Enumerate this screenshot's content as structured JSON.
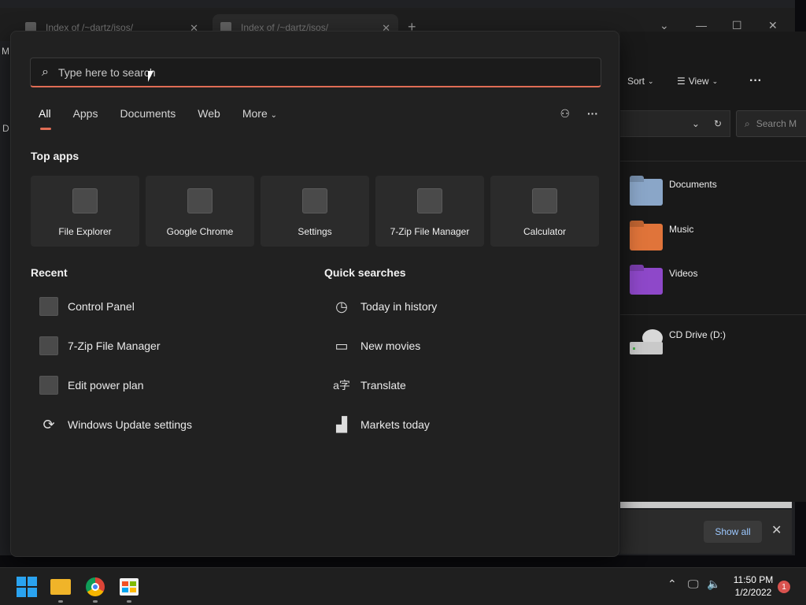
{
  "browser": {
    "tabs": [
      {
        "title": "Index of /~dartz/isos/"
      },
      {
        "title": "Index of /~dartz/isos/"
      }
    ],
    "new_tab_label": "+",
    "window_controls": [
      "⌄",
      "—",
      "☐",
      "✕"
    ],
    "left_letters": [
      "M",
      "D"
    ]
  },
  "explorer": {
    "toolbar": {
      "sort": "Sort",
      "view": "View",
      "more": "···"
    },
    "search_placeholder": "Search M",
    "items": [
      {
        "label": "Documents",
        "icon": "folder-documents-icon"
      },
      {
        "label": "Music",
        "icon": "folder-music-icon"
      },
      {
        "label": "Videos",
        "icon": "folder-videos-icon"
      },
      {
        "label": "CD Drive (D:)",
        "icon": "cd-drive-icon"
      }
    ]
  },
  "notification": {
    "show_all": "Show all",
    "close": "✕"
  },
  "start": {
    "search_placeholder": "Type here to search",
    "tabs": [
      "All",
      "Apps",
      "Documents",
      "Web",
      "More"
    ],
    "top_apps_title": "Top apps",
    "top_apps": [
      {
        "name": "File Explorer"
      },
      {
        "name": "Google Chrome"
      },
      {
        "name": "Settings"
      },
      {
        "name": "7-Zip File Manager"
      },
      {
        "name": "Calculator"
      }
    ],
    "recent_title": "Recent",
    "recent": [
      {
        "name": "Control Panel",
        "icon": "generic-app-icon"
      },
      {
        "name": "7-Zip File Manager",
        "icon": "generic-app-icon"
      },
      {
        "name": "Edit power plan",
        "icon": "generic-app-icon"
      },
      {
        "name": "Windows Update settings",
        "icon": "refresh-icon"
      }
    ],
    "quick_title": "Quick searches",
    "quick": [
      {
        "name": "Today in history",
        "icon": "clock-icon"
      },
      {
        "name": "New movies",
        "icon": "clapperboard-icon"
      },
      {
        "name": "Translate",
        "icon": "translate-icon"
      },
      {
        "name": "Markets today",
        "icon": "chart-icon"
      }
    ]
  },
  "taskbar": {
    "clock_time": "11:50 PM",
    "clock_date": "1/2/2022",
    "notification_count": "1"
  },
  "colors": {
    "accent": "#e06d55",
    "panel_bg": "#212121",
    "taskbar_bg": "#1f1f1f"
  }
}
